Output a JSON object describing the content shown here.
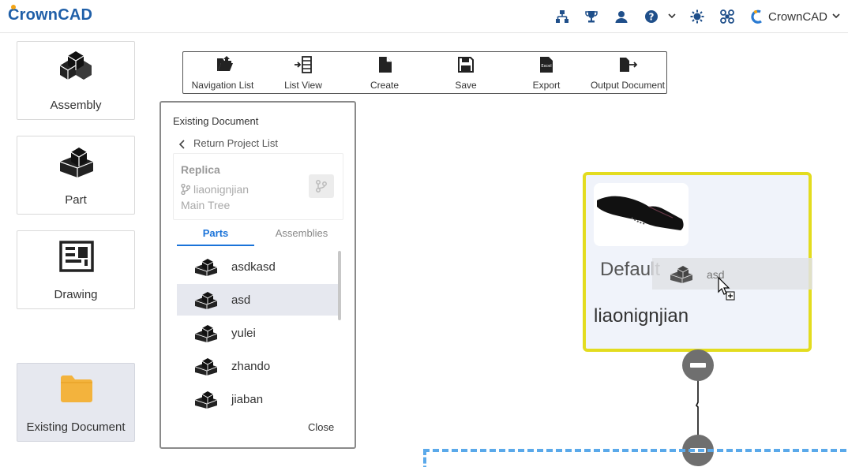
{
  "header": {
    "logo_text": "CrownCAD",
    "user_name": "CrownCAD",
    "icons": [
      "org-chart-icon",
      "trophy-icon",
      "user-icon",
      "help-icon",
      "chevron-down-icon",
      "settings-icon",
      "apps-icon",
      "crown-logo-icon",
      "chevron-down-icon"
    ]
  },
  "nav": {
    "items": [
      {
        "label": "Assembly",
        "icon": "assembly-icon"
      },
      {
        "label": "Part",
        "icon": "part-icon"
      },
      {
        "label": "Drawing",
        "icon": "drawing-icon"
      },
      {
        "label": "Existing Document",
        "icon": "folder-icon"
      }
    ],
    "active": "Existing Document"
  },
  "toolbar": {
    "tools": [
      {
        "label": "Navigation List",
        "icon": "folder-open-icon"
      },
      {
        "label": "List View",
        "icon": "list-view-icon"
      },
      {
        "label": "Create",
        "icon": "document-icon"
      },
      {
        "label": "Save",
        "icon": "save-icon"
      },
      {
        "label": "Export",
        "icon": "excel-icon"
      },
      {
        "label": "Output Document",
        "icon": "output-document-icon"
      }
    ]
  },
  "panel": {
    "title": "Existing Document",
    "return_label": "Return Project List",
    "project": {
      "name": "Replica",
      "owner": "liaonignjian",
      "tree": "Main Tree"
    },
    "tabs": [
      "Parts",
      "Assemblies"
    ],
    "active_tab": "Parts",
    "parts": [
      "asdkasd",
      "asd",
      "yulei",
      "zhando",
      "jiaban"
    ],
    "selected_part": "asd",
    "close_label": "Close"
  },
  "canvas": {
    "node": {
      "configuration": "Default",
      "name": "liaonignjian"
    },
    "drag_ghost_label": "asd",
    "colors": {
      "node_border": "#e3dc1f",
      "node_bg": "#f0f3fa",
      "accent": "#1a73d9",
      "dashed_border": "#5aa9ea",
      "collapse_button": "#6f6f6f"
    }
  }
}
